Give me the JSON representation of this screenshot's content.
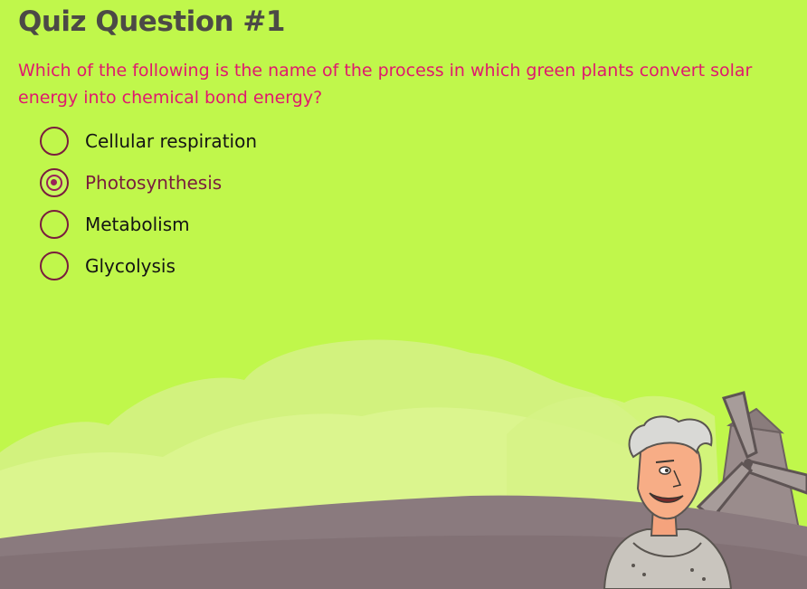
{
  "quiz": {
    "title": "Quiz Question #1",
    "question": "Which of the following is the name of the process in which green plants convert solar energy into chemical bond energy?",
    "options": [
      {
        "label": "Cellular respiration",
        "selected": false
      },
      {
        "label": "Photosynthesis",
        "selected": true
      },
      {
        "label": "Metabolism",
        "selected": false
      },
      {
        "label": "Glycolysis",
        "selected": false
      }
    ]
  },
  "colors": {
    "background": "#c0f74b",
    "title": "#4c4a46",
    "question": "#e0186e",
    "radio_border": "#7a1d3e",
    "ground": "#8a7a7e"
  },
  "illustration": {
    "character": "cartoon-old-man-icon",
    "building": "windmill-icon"
  }
}
